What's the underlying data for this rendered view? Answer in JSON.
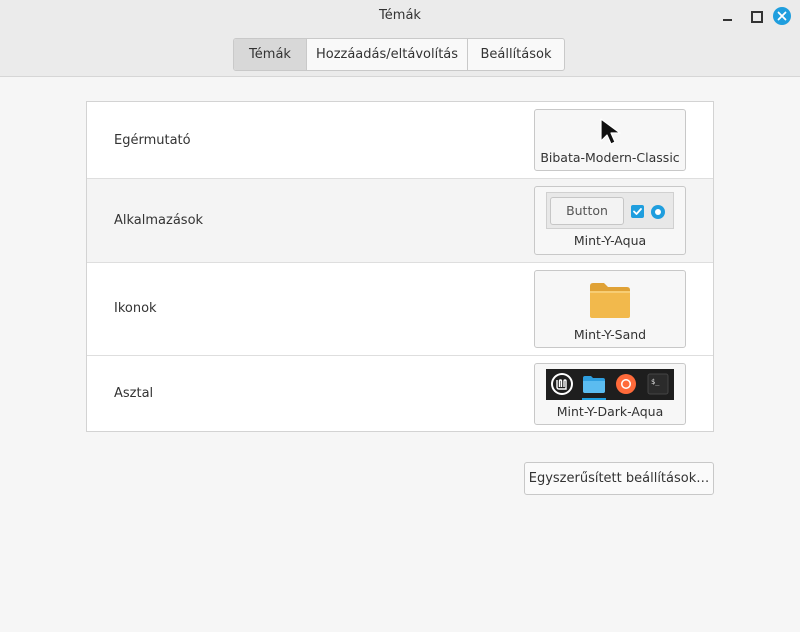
{
  "window": {
    "title": "Témák"
  },
  "tabs": [
    {
      "label": "Témák",
      "active": true
    },
    {
      "label": "Hozzáadás/eltávolítás",
      "active": false
    },
    {
      "label": "Beállítások",
      "active": false
    }
  ],
  "rows": [
    {
      "label": "Egérmutató",
      "value": "Bibata-Modern-Classic",
      "preview_icon": "cursor-arrow-icon"
    },
    {
      "label": "Alkalmazások",
      "value": "Mint-Y-Aqua",
      "preview_button_label": "Button",
      "preview_icon": "widget-preview"
    },
    {
      "label": "Ikonok",
      "value": "Mint-Y-Sand",
      "preview_icon": "folder-icon"
    },
    {
      "label": "Asztal",
      "value": "Mint-Y-Dark-Aqua",
      "preview_icon": "panel-preview"
    }
  ],
  "simple_settings_button": "Egyszerűsített beállítások…",
  "colors": {
    "accent": "#1f9ede",
    "folder": "#f2b94c",
    "titlebar": "#ebebeb",
    "background": "#f6f6f6"
  }
}
